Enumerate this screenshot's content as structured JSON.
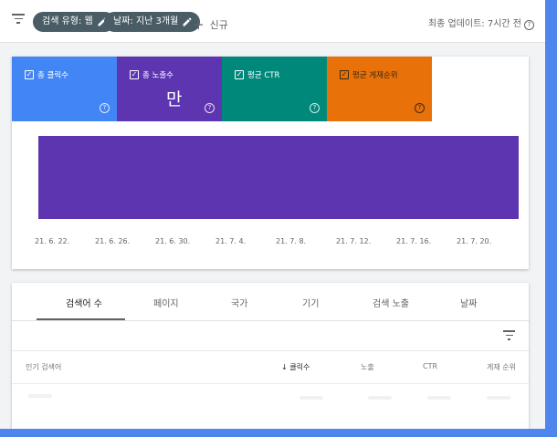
{
  "toolbar": {
    "chips": [
      {
        "label": "검색 유형: 웹"
      },
      {
        "label": "날짜: 지난 3개월"
      }
    ],
    "new_label": "신규",
    "last_updated": "최종 업데이트: 7시간 전"
  },
  "metrics": [
    {
      "label": "총 클릭수",
      "value": "",
      "color": "#4285f4",
      "checked": true
    },
    {
      "label": "총 노출수",
      "value": "만",
      "color": "#5e35b1",
      "checked": true
    },
    {
      "label": "평균 CTR",
      "value": "",
      "color": "#00897b",
      "checked": true
    },
    {
      "label": "평균 게재순위",
      "value": "",
      "color": "#e8710a",
      "checked": true
    }
  ],
  "chart_data": {
    "type": "area",
    "x": [
      "21. 6. 22.",
      "21. 6. 26.",
      "21. 6. 30.",
      "21. 7. 4.",
      "21. 7. 8.",
      "21. 7. 12.",
      "21. 7. 16.",
      "21. 7. 20."
    ],
    "series": [
      {
        "name": "총 노출수",
        "color": "#5e35b1",
        "values": [
          1,
          1,
          1,
          1,
          1,
          1,
          1,
          1
        ]
      }
    ],
    "ylim": [
      0,
      1
    ],
    "grid": false
  },
  "tabs": [
    {
      "label": "검색어 수",
      "active": true
    },
    {
      "label": "페이지"
    },
    {
      "label": "국가"
    },
    {
      "label": "기기"
    },
    {
      "label": "검색 노출"
    },
    {
      "label": "날짜"
    }
  ],
  "table": {
    "columns": [
      {
        "label": "인기 검색어"
      },
      {
        "label": "클릭수",
        "sorted": true,
        "sort_arrow": "↓"
      },
      {
        "label": "노출"
      },
      {
        "label": "CTR"
      },
      {
        "label": "게재 순위"
      }
    ]
  }
}
